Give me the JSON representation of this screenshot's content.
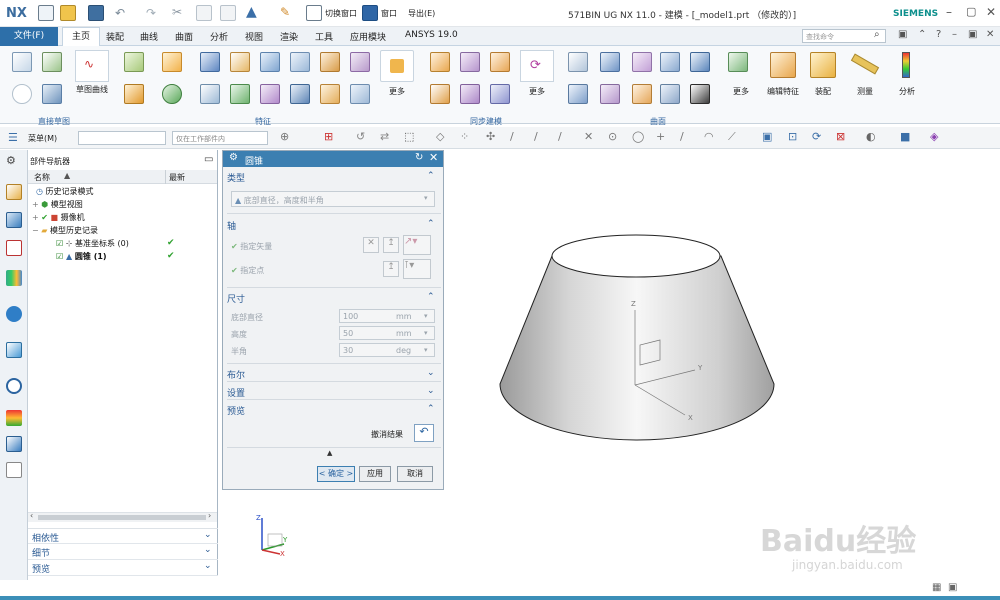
{
  "app": {
    "logo": "NX",
    "title": "571BIN UG NX 11.0 - 建模 - [_model1.prt （修改的）]",
    "brand": "SIEMENS",
    "switch_window": "切换窗口",
    "window_menu": "窗口",
    "export_menu": "导出(E)"
  },
  "tabs": [
    {
      "label": "文件(F)"
    },
    {
      "label": "主页"
    },
    {
      "label": "装配"
    },
    {
      "label": "曲线"
    },
    {
      "label": "曲面"
    },
    {
      "label": "分析"
    },
    {
      "label": "视图"
    },
    {
      "label": "渲染"
    },
    {
      "label": "工具"
    },
    {
      "label": "应用模块"
    },
    {
      "label": "ANSYS 19.0"
    }
  ],
  "search": {
    "placeholder": "查找命令"
  },
  "ribbon": {
    "sketch_curve_label": "草图曲线",
    "direct_sketch": "直接草图",
    "feature": "特征",
    "sync_modeling": "同步建模",
    "surface": "曲面",
    "more": "更多",
    "edit_feature": "编辑特征",
    "assembly": "装配",
    "measure": "测量",
    "analysis": "分析"
  },
  "toolbar2": {
    "menu": "菜单(M)",
    "filter": "",
    "scope": "仅在工作部件内"
  },
  "navigator": {
    "title": "部件导航器",
    "col_name": "名称",
    "col_latest": "最新",
    "rows": [
      {
        "label": "历史记录模式"
      },
      {
        "label": "模型视图"
      },
      {
        "label": "摄像机"
      },
      {
        "label": "模型历史记录"
      },
      {
        "label": "基准坐标系 (0)"
      },
      {
        "label": "圆锥 (1)"
      }
    ],
    "bottom": [
      {
        "label": "相依性"
      },
      {
        "label": "细节"
      },
      {
        "label": "预览"
      }
    ]
  },
  "dialog": {
    "title": "圆锥",
    "sec_type": "类型",
    "type_value": "底部直径，高度和半角",
    "sec_axis": "轴",
    "specify_vector": "指定矢量",
    "specify_point": "指定点",
    "sec_size": "尺寸",
    "base_dia_label": "底部直径",
    "base_dia_value": "100",
    "base_dia_unit": "mm",
    "height_label": "高度",
    "height_value": "50",
    "height_unit": "mm",
    "half_angle_label": "半角",
    "half_angle_value": "30",
    "half_angle_unit": "deg",
    "sec_bool": "布尔",
    "sec_settings": "设置",
    "sec_preview": "预览",
    "undo_result": "撤消结果",
    "ok": "< 确定 >",
    "apply": "应用",
    "cancel": "取消"
  },
  "triad": {
    "z": "Z",
    "y": "Y",
    "x": "X"
  },
  "watermark": {
    "text": "Baidu经验",
    "url": "jingyan.baidu.com"
  },
  "colors": {
    "accent": "#2d6fa9",
    "tab_active": "#ffffff",
    "dialog_header": "#3c7fb1",
    "check": "#2fa12f"
  }
}
